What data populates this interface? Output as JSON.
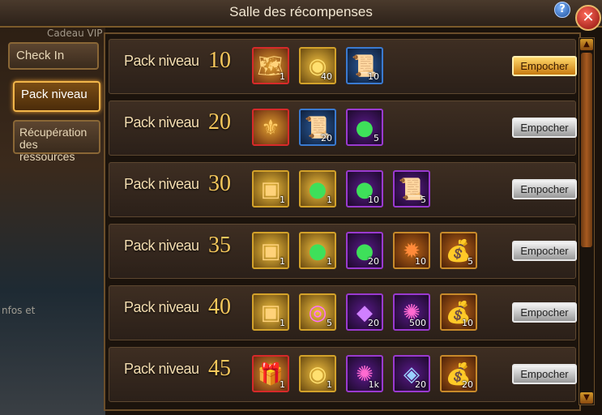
{
  "window": {
    "title": "Salle des récompenses",
    "help_symbol": "?",
    "close_symbol": "✕"
  },
  "background_text": {
    "gift_tab": "Cadeau VIP",
    "left_text": "nfos et"
  },
  "sidebar": {
    "items": [
      {
        "label": "Check In",
        "active": false
      },
      {
        "label": "Pack niveau",
        "active": true
      },
      {
        "label": "Récupération des ressources",
        "active": false
      }
    ]
  },
  "packs": [
    {
      "label": "Pack niveau",
      "level": "10",
      "button": "Empocher",
      "button_state": "available",
      "rewards": [
        {
          "icon": "map-scroll-icon",
          "rarity": "legendary",
          "count": "1"
        },
        {
          "icon": "gold-orb-icon",
          "rarity": "gold",
          "count": "40"
        },
        {
          "icon": "scroll-icon",
          "rarity": "blue",
          "count": "10"
        }
      ]
    },
    {
      "label": "Pack niveau",
      "level": "20",
      "button": "Empocher",
      "button_state": "locked",
      "rewards": [
        {
          "icon": "emblem-icon",
          "rarity": "legendary",
          "count": ""
        },
        {
          "icon": "scroll-icon",
          "rarity": "blue",
          "count": "20"
        },
        {
          "icon": "green-orb-icon",
          "rarity": "purple",
          "count": "5"
        }
      ]
    },
    {
      "label": "Pack niveau",
      "level": "30",
      "button": "Empocher",
      "button_state": "locked",
      "rewards": [
        {
          "icon": "treasure-chest-icon",
          "rarity": "gold",
          "count": "1"
        },
        {
          "icon": "green-orb-icon",
          "rarity": "gold",
          "count": "1"
        },
        {
          "icon": "green-orb-icon",
          "rarity": "purple",
          "count": "10"
        },
        {
          "icon": "scroll-icon",
          "rarity": "purple",
          "count": "5"
        }
      ]
    },
    {
      "label": "Pack niveau",
      "level": "35",
      "button": "Empocher",
      "button_state": "locked",
      "rewards": [
        {
          "icon": "treasure-chest-icon",
          "rarity": "gold",
          "count": "1"
        },
        {
          "icon": "green-orb-icon",
          "rarity": "gold",
          "count": "1"
        },
        {
          "icon": "green-orb-icon",
          "rarity": "purple",
          "count": "20"
        },
        {
          "icon": "fire-orb-icon",
          "rarity": "orange",
          "count": "10"
        },
        {
          "icon": "gold-sack-icon",
          "rarity": "orange",
          "count": "5"
        }
      ]
    },
    {
      "label": "Pack niveau",
      "level": "40",
      "button": "Empocher",
      "button_state": "locked",
      "rewards": [
        {
          "icon": "treasure-chest-icon",
          "rarity": "gold",
          "count": "1"
        },
        {
          "icon": "purple-eye-icon",
          "rarity": "gold",
          "count": "5"
        },
        {
          "icon": "purple-gem-icon",
          "rarity": "purple",
          "count": "20"
        },
        {
          "icon": "magic-swirl-icon",
          "rarity": "purple",
          "count": "500"
        },
        {
          "icon": "gold-sack-icon",
          "rarity": "orange",
          "count": "10"
        }
      ]
    },
    {
      "label": "Pack niveau",
      "level": "45",
      "button": "Empocher",
      "button_state": "locked",
      "rewards": [
        {
          "icon": "open-chest-icon",
          "rarity": "legendary",
          "count": "1"
        },
        {
          "icon": "gold-orb-icon",
          "rarity": "gold",
          "count": "1"
        },
        {
          "icon": "magic-swirl-icon",
          "rarity": "purple",
          "count": "1k"
        },
        {
          "icon": "blue-shard-icon",
          "rarity": "purple",
          "count": "20"
        },
        {
          "icon": "gold-sack-icon",
          "rarity": "orange",
          "count": "20"
        }
      ]
    }
  ],
  "scroll": {
    "up_symbol": "▲",
    "down_symbol": "▼"
  },
  "colors": {
    "title": "#f2e7d2",
    "level_number": "#f6c85c",
    "button_gold": "#e8a22a"
  }
}
